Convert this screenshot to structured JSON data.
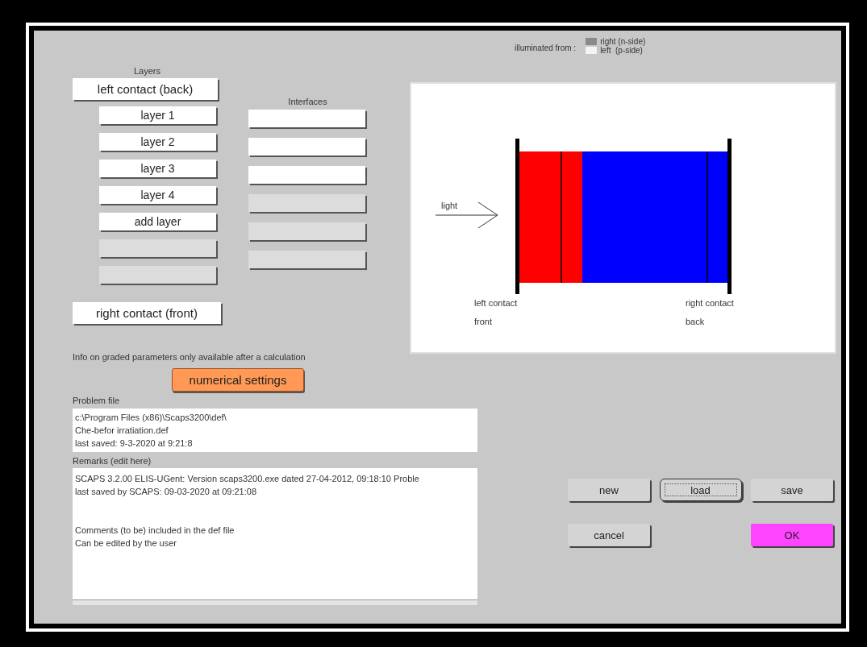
{
  "layers": {
    "title": "Layers",
    "items": [
      {
        "kind": "contact",
        "label": "left contact (back)"
      },
      {
        "kind": "layer",
        "label": "layer 1"
      },
      {
        "kind": "layer",
        "label": "layer 2"
      },
      {
        "kind": "layer",
        "label": "layer 3"
      },
      {
        "kind": "layer",
        "label": "layer 4"
      },
      {
        "kind": "layer",
        "label": "add layer"
      },
      {
        "kind": "blank",
        "disabled": true
      },
      {
        "kind": "blank",
        "disabled": true
      },
      {
        "kind": "contact",
        "label": "right contact (front)"
      }
    ]
  },
  "interfaces": {
    "title": "Interfaces",
    "items": [
      {
        "disabled": false
      },
      {
        "disabled": false
      },
      {
        "disabled": false
      },
      {
        "disabled": true
      },
      {
        "disabled": true
      },
      {
        "disabled": true
      }
    ]
  },
  "illumination": {
    "label": "illuminated from :",
    "options": [
      {
        "label": "right (n-side)",
        "selected": true
      },
      {
        "label": "left  (p-side)",
        "selected": false
      }
    ]
  },
  "diagram": {
    "light_label": "light",
    "left_contact": [
      "left contact",
      "front"
    ],
    "right_contact": [
      "right contact",
      "back"
    ]
  },
  "info": "Info on graded parameters only available after a calculation",
  "numerical_settings": "numerical settings",
  "problem_file": {
    "label": "Problem file",
    "lines": [
      "c:\\Program Files (x86)\\Scaps3200\\def\\",
      "Che-befor irratiation.def",
      "last saved: 9-3-2020 at 9:21:8"
    ]
  },
  "remarks": {
    "label": "Remarks (edit here)",
    "paragraphs": [
      [
        "SCAPS 3.2.00 ELIS-UGent: Version scaps3200.exe dated 27-04-2012, 09:18:10 Proble",
        "last saved by SCAPS: 09-03-2020 at 09:21:08"
      ],
      [
        "Comments (to be) included in the def file",
        "Can be edited by the user"
      ]
    ]
  },
  "actions": [
    {
      "buttons": [
        {
          "label": "new",
          "kind": "plain",
          "focused": false
        },
        {
          "label": "load",
          "kind": "plain",
          "focused": true
        },
        {
          "label": "save",
          "kind": "plain",
          "focused": false
        }
      ]
    },
    {
      "buttons": [
        {
          "label": "cancel",
          "kind": "plain",
          "focused": false
        },
        {
          "label": "OK",
          "kind": "default",
          "focused": false
        }
      ]
    }
  ]
}
